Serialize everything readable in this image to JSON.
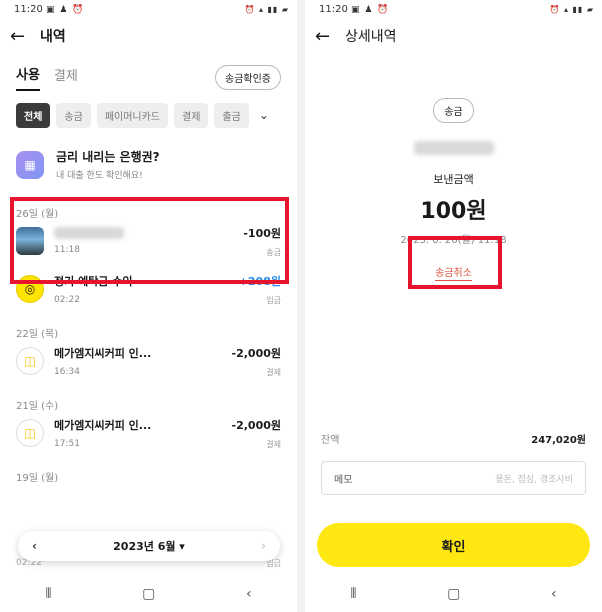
{
  "left": {
    "status_time": "11:20",
    "header_title": "내역",
    "tabs": [
      {
        "label": "사용"
      },
      {
        "label": "결제"
      }
    ],
    "transfer_confirm_label": "송금확인증",
    "filter_chips": [
      {
        "label": "전체"
      },
      {
        "label": "송금"
      },
      {
        "label": "페이머니카드"
      },
      {
        "label": "결제"
      },
      {
        "label": "출금"
      }
    ],
    "promo": {
      "title": "금리 내리는 은행권?",
      "subtitle": "내 대출 한도 확인해요!"
    },
    "groups": [
      {
        "date": "26일 (월)",
        "items": [
          {
            "time": "11:18",
            "amount": "-100원",
            "type": "송금"
          },
          {
            "name": "정기 예탁금 수익",
            "time": "02:22",
            "amount": "+208원",
            "type": "입금"
          }
        ]
      },
      {
        "date": "22일 (목)",
        "items": [
          {
            "name": "메가엠지씨커피 인...",
            "time": "16:34",
            "amount": "-2,000원",
            "type": "결제"
          }
        ]
      },
      {
        "date": "21일 (수)",
        "items": [
          {
            "name": "메가엠지씨커피 인...",
            "time": "17:51",
            "amount": "-2,000원",
            "type": "결제"
          }
        ]
      },
      {
        "date": "19일 (월)"
      }
    ],
    "bottom_time": "02:22",
    "bottom_type": "입금",
    "month_label": "2023년 6월 ▾"
  },
  "right": {
    "status_time": "11:20",
    "header_title": "상세내역",
    "type_badge": "송금",
    "sent_label": "보낸금액",
    "amount": "100원",
    "datetime": "2023. 6. 26(월) 11:18",
    "cancel_label": "송금취소",
    "balance_label": "잔액",
    "balance_value": "247,020원",
    "memo_label": "메모",
    "memo_placeholder": "용돈, 점심, 경조사비",
    "confirm_label": "확인"
  },
  "colors": {
    "accent_yellow": "#ffe812",
    "highlight_red": "#e6142d",
    "plus_blue": "#2b8ef0",
    "cancel_red": "#e0533c"
  },
  "icons": [
    "back-arrow-icon",
    "chevron-down-icon",
    "coin-icon",
    "shopping-bag-icon",
    "gift-icon"
  ]
}
